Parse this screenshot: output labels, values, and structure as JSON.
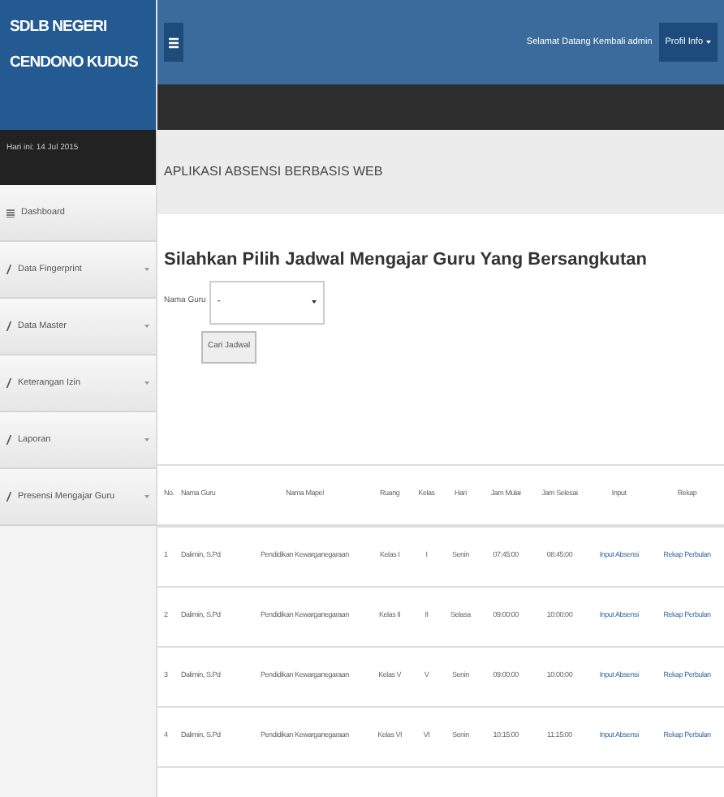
{
  "brand": {
    "line1": "SDLB NEGERI",
    "line2": "CENDONO KUDUS"
  },
  "date": "Hari ini: 14 Jul 2015",
  "topbar": {
    "greeting": "Selamat Datang Kembali admin",
    "profile": "Profil Info"
  },
  "sidebar": {
    "items": [
      {
        "label": "Dashboard",
        "kind": "plain"
      },
      {
        "label": "Data Fingerprint",
        "kind": "dropdown"
      },
      {
        "label": "Data Master",
        "kind": "dropdown"
      },
      {
        "label": "Keterangan Izin",
        "kind": "dropdown"
      },
      {
        "label": "Laporan",
        "kind": "dropdown"
      },
      {
        "label": "Presensi Mengajar Guru",
        "kind": "dropdown"
      }
    ]
  },
  "page_title": "APLIKASI ABSENSI BERBASIS WEB",
  "heading": "Silahkan Pilih Jadwal Mengajar Guru Yang Bersangkutan",
  "form": {
    "label": "Nama Guru",
    "value": "-",
    "button": "Cari Jadwal"
  },
  "table": {
    "columns": [
      "No.",
      "Nama Guru",
      "Nama Mapel",
      "Ruang",
      "Kelas",
      "Hari",
      "Jam Mulai",
      "Jam Selesai",
      "Input",
      "Rekap"
    ],
    "rows": [
      [
        "1",
        "Dalimin, S.Pd",
        "Pendidikan Kewarganegaraan",
        "Kelas I",
        "I",
        "Senin",
        "07:45:00",
        "08:45:00",
        "Input Absensi",
        "Rekap Perbulan"
      ],
      [
        "2",
        "Dalimin, S.Pd",
        "Pendidikan Kewarganegaraan",
        "Kelas II",
        "II",
        "Selasa",
        "09:00:00",
        "10:00:00",
        "Input Absensi",
        "Rekap Perbulan"
      ],
      [
        "3",
        "Dalimin, S.Pd",
        "Pendidikan Kewarganegaraan",
        "Kelas V",
        "V",
        "Senin",
        "09:00:00",
        "10:00:00",
        "Input Absensi",
        "Rekap Perbulan"
      ],
      [
        "4",
        "Dalimin, S.Pd",
        "Pendidikan Kewarganegaraan",
        "Kelas VI",
        "VI",
        "Senin",
        "10:15:00",
        "11:15:00",
        "Input Absensi",
        "Rekap Perbulan"
      ]
    ]
  }
}
